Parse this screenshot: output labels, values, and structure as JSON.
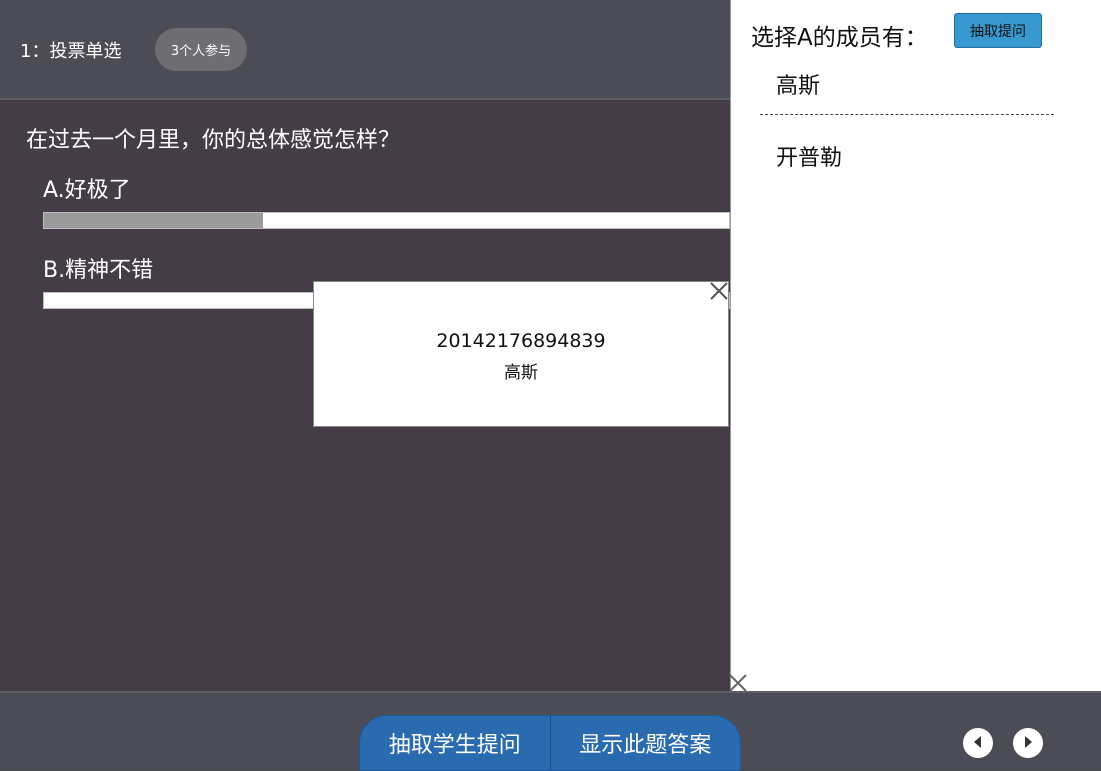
{
  "header": {
    "question_type": "1：投票单选",
    "participants_badge": "3个人参与"
  },
  "question": {
    "text": "在过去一个月里，你的总体感觉怎样？",
    "options": [
      {
        "label": "A.好极了",
        "fill_fraction": 0.32
      },
      {
        "label": "B.精神不错",
        "fill_fraction": 0.0
      }
    ]
  },
  "popup": {
    "student_id": "20142176894839",
    "student_name": "高斯",
    "close_icon": "close-icon"
  },
  "side_panel": {
    "title": "选择A的成员有：",
    "draw_button": "抽取提问",
    "members": [
      "高斯",
      "开普勒"
    ],
    "close_icon": "close-icon"
  },
  "footer": {
    "draw_student_button": "抽取学生提问",
    "show_answer_button": "显示此题答案",
    "prev_icon": "caret-left-icon",
    "next_icon": "caret-right-icon"
  },
  "colors": {
    "header_bg": "#4b4c55",
    "main_bg": "#443c47",
    "accent_button": "#3899d0",
    "footer_button": "#2a6bb0",
    "bar_fill": "#9a9a9a"
  }
}
